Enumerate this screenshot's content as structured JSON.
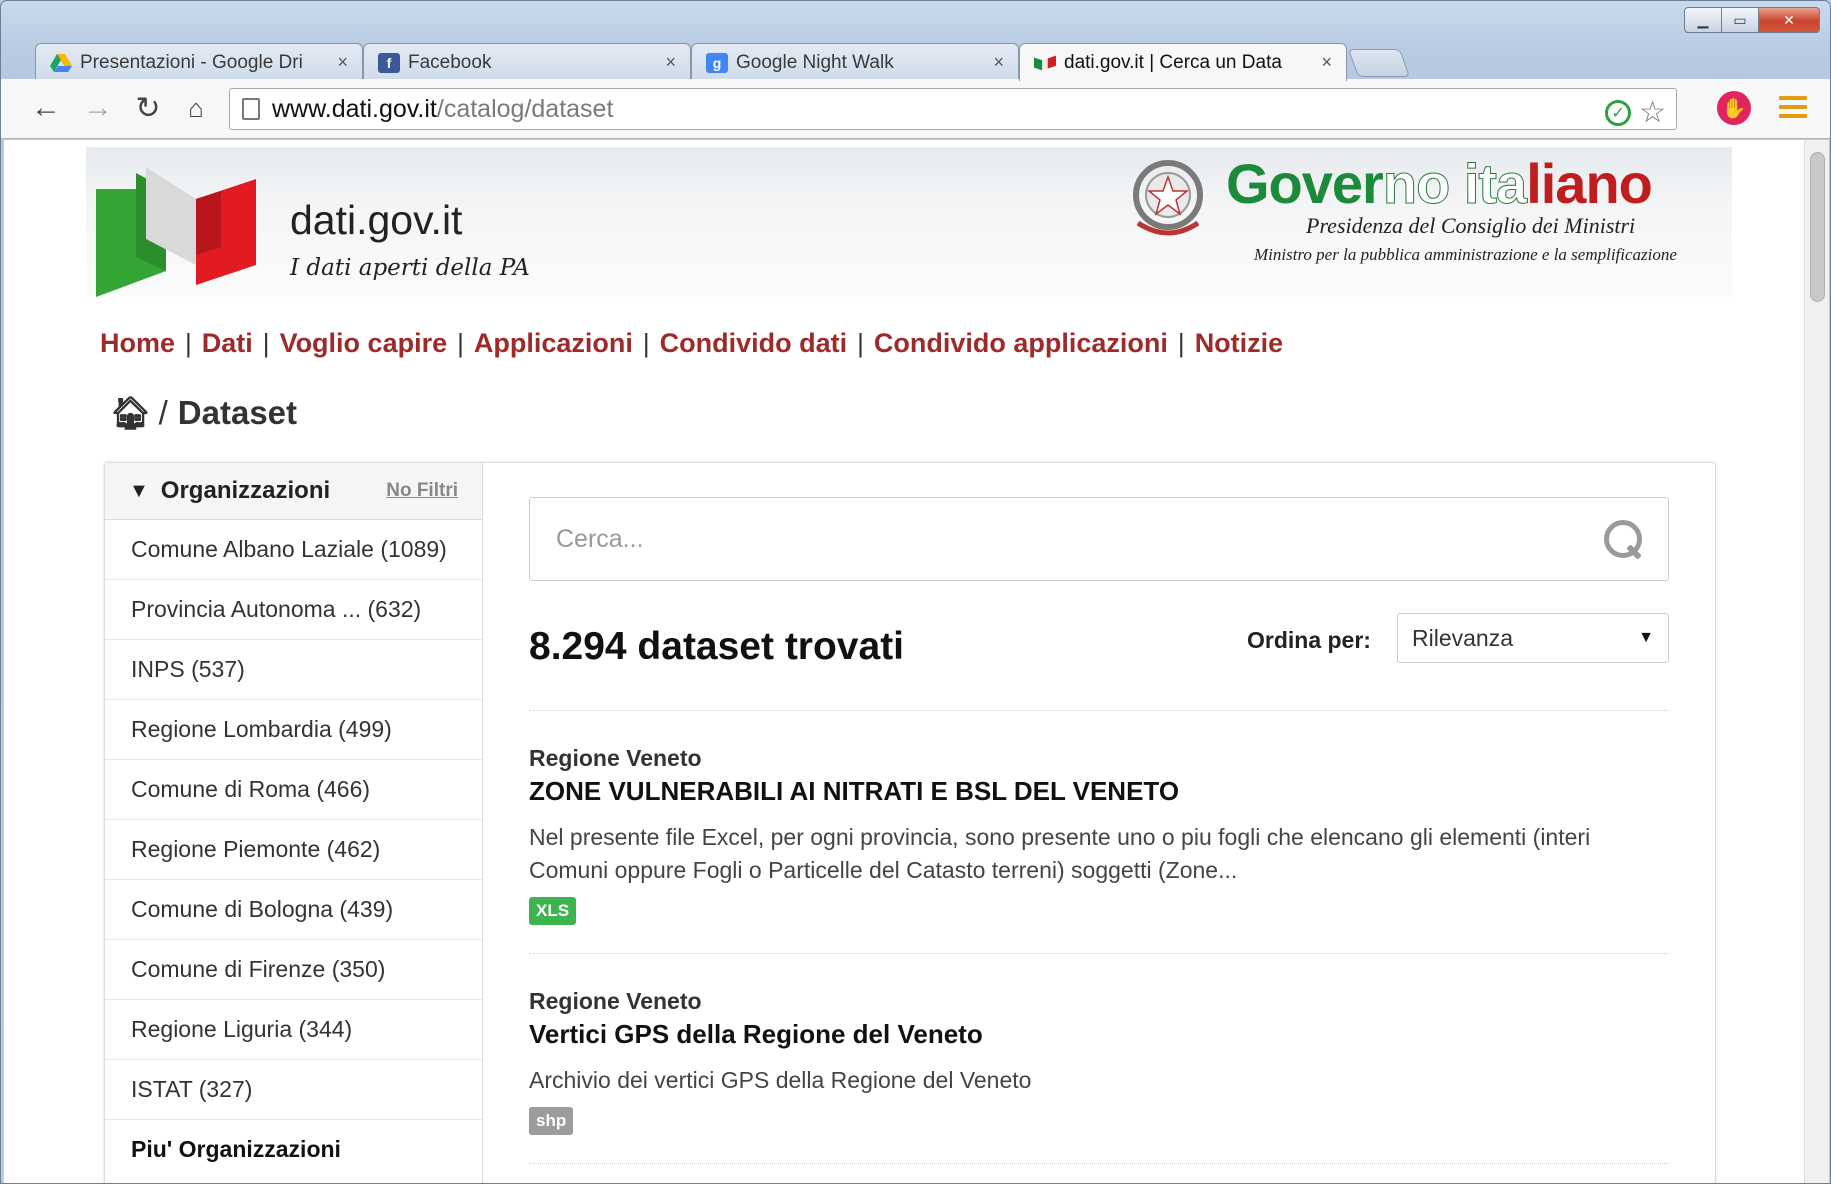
{
  "browser": {
    "tabs": [
      {
        "title": "Presentazioni - Google Dri",
        "icon": "google-drive-icon",
        "color": "#f6b800",
        "active": false
      },
      {
        "title": "Facebook",
        "icon": "facebook-icon",
        "color": "#3b5998",
        "active": false
      },
      {
        "title": "Google Night Walk",
        "icon": "google-icon",
        "color": "#4285f4",
        "active": false
      },
      {
        "title": "dati.gov.it | Cerca un Data",
        "icon": "italian-flag-icon",
        "color": "#1c8a3a",
        "active": true
      }
    ],
    "tab_close": "×",
    "url_host": "www.dati.gov.it",
    "url_path": "/catalog/dataset"
  },
  "header": {
    "site_title": "dati.gov.it",
    "site_subtitle": "I dati aperti della PA",
    "gov_title_1": "Gover",
    "gov_title_2": "no ita",
    "gov_title_3": "liano",
    "gov_sub1": "Presidenza del Consiglio dei Ministri",
    "gov_sub2": "Ministro per la pubblica amministrazione e la semplificazione"
  },
  "nav": {
    "items": [
      "Home",
      "Dati",
      "Voglio capire",
      "Applicazioni",
      "Condivido dati",
      "Condivido applicazioni",
      "Notizie"
    ],
    "separator": "|"
  },
  "breadcrumb": {
    "slash": "/",
    "label": "Dataset"
  },
  "sidebar": {
    "title": "Organizzazioni",
    "no_filter": "No Filtri",
    "items": [
      "Comune Albano Laziale (1089)",
      "Provincia Autonoma ... (632)",
      "INPS (537)",
      "Regione Lombardia (499)",
      "Comune di Roma (466)",
      "Regione Piemonte (462)",
      "Comune di Bologna (439)",
      "Comune di Firenze (350)",
      "Regione Liguria (344)",
      "ISTAT (327)"
    ],
    "more": "Piu' Organizzazioni"
  },
  "search": {
    "placeholder": "Cerca..."
  },
  "results": {
    "count": "8.294 dataset trovati",
    "sort_label": "Ordina per:",
    "sort_value": "Rilevanza",
    "items": [
      {
        "org": "Regione Veneto",
        "title": "ZONE VULNERABILI AI NITRATI E BSL DEL VENETO",
        "desc": "Nel presente file Excel, per ogni provincia, sono presente uno o piu fogli che elencano gli elementi (interi Comuni oppure Fogli o Particelle del Catasto terreni) soggetti (Zone...",
        "format": "XLS"
      },
      {
        "org": "Regione Veneto",
        "title": "Vertici GPS della Regione del Veneto",
        "desc": "Archivio dei vertici GPS della Regione del Veneto",
        "format": "shp"
      }
    ]
  }
}
